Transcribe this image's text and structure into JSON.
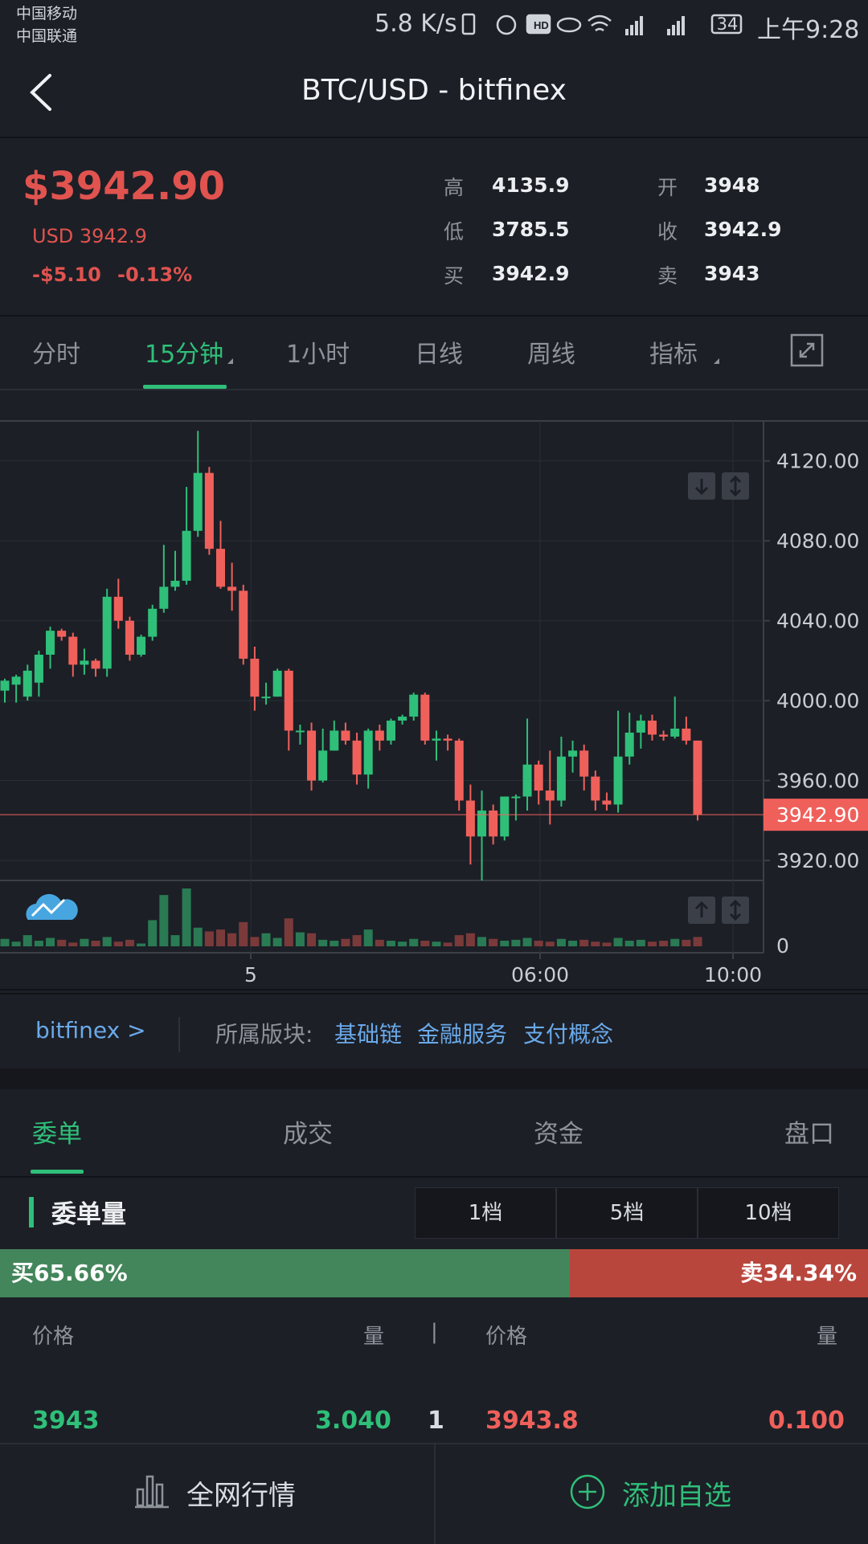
{
  "status_bar": {
    "carrier1": "中国移动",
    "carrier2": "中国联通",
    "speed": "5.8 K/s",
    "battery": "34",
    "time": "上午9:28",
    "icons": [
      "vibrate-icon",
      "alarm-icon",
      "hd-icon",
      "eye-icon",
      "wifi-icon",
      "signal-4g-icon",
      "signal-2g-icon",
      "battery-icon"
    ]
  },
  "header": {
    "title": "BTC/USD - bitfinex",
    "back_icon": "chevron-left-icon"
  },
  "price": {
    "main": "$3942.90",
    "usd": "USD 3942.9",
    "change": "-$5.10",
    "change_pct": "-0.13%",
    "color_down": "#e0534f",
    "quotes": [
      {
        "label": "高",
        "value": "4135.9"
      },
      {
        "label": "开",
        "value": "3948"
      },
      {
        "label": "低",
        "value": "3785.5"
      },
      {
        "label": "收",
        "value": "3942.9"
      },
      {
        "label": "买",
        "value": "3942.9"
      },
      {
        "label": "卖",
        "value": "3943"
      }
    ]
  },
  "tabs": {
    "items": [
      "分时",
      "15分钟",
      "1小时",
      "日线",
      "周线",
      "指标"
    ],
    "active": "15分钟",
    "expand_icon": "fullscreen-icon"
  },
  "chart_data": {
    "type": "candlestick",
    "y_ticks": [
      "4120.00",
      "4080.00",
      "4040.00",
      "4000.00",
      "3960.00",
      "3920.00"
    ],
    "ylim": [
      3910,
      4140
    ],
    "x_ticks": [
      "5",
      "06:00",
      "10:00"
    ],
    "current_price_label": "3942.90",
    "volume_zero_label": "0",
    "up_color": "#2fbf79",
    "down_color": "#f0605b",
    "candles": [
      [
        4005,
        4010,
        3999,
        4011
      ],
      [
        4008,
        4012,
        3999,
        4013
      ],
      [
        4002,
        4015,
        4000,
        4018
      ],
      [
        4009,
        4023,
        4002,
        4025
      ],
      [
        4023,
        4035,
        4016,
        4037
      ],
      [
        4035,
        4032,
        4030,
        4036
      ],
      [
        4032,
        4018,
        4012,
        4034
      ],
      [
        4018,
        4020,
        4013,
        4026
      ],
      [
        4020,
        4016,
        4012,
        4021
      ],
      [
        4016,
        4052,
        4012,
        4056
      ],
      [
        4052,
        4040,
        4036,
        4061
      ],
      [
        4040,
        4023,
        4020,
        4042
      ],
      [
        4023,
        4032,
        4022,
        4033
      ],
      [
        4032,
        4046,
        4030,
        4048
      ],
      [
        4046,
        4057,
        4044,
        4078
      ],
      [
        4057,
        4060,
        4055,
        4075
      ],
      [
        4060,
        4085,
        4058,
        4107
      ],
      [
        4085,
        4114,
        4082,
        4135
      ],
      [
        4114,
        4076,
        4073,
        4117
      ],
      [
        4076,
        4057,
        4056,
        4090
      ],
      [
        4057,
        4055,
        4045,
        4069
      ],
      [
        4055,
        4021,
        4018,
        4058
      ],
      [
        4021,
        4002,
        3995,
        4027
      ],
      [
        4002,
        4002,
        3998,
        4009
      ],
      [
        4002,
        4015,
        4002,
        4016
      ],
      [
        4015,
        3985,
        3975,
        4016
      ],
      [
        3985,
        3985,
        3978,
        3988
      ],
      [
        3985,
        3960,
        3955,
        3989
      ],
      [
        3960,
        3975,
        3959,
        3986
      ],
      [
        3975,
        3985,
        3975,
        3990
      ],
      [
        3985,
        3980,
        3978,
        3989
      ],
      [
        3980,
        3963,
        3958,
        3984
      ],
      [
        3963,
        3985,
        3956,
        3986
      ],
      [
        3985,
        3980,
        3975,
        3988
      ],
      [
        3980,
        3990,
        3978,
        3991
      ],
      [
        3990,
        3992,
        3988,
        3993
      ],
      [
        3992,
        4003,
        3990,
        4004
      ],
      [
        4003,
        3980,
        3978,
        4004
      ],
      [
        3980,
        3981,
        3970,
        3985
      ],
      [
        3981,
        3980,
        3975,
        3983
      ],
      [
        3980,
        3950,
        3945,
        3981
      ],
      [
        3950,
        3932,
        3918,
        3958
      ],
      [
        3932,
        3945,
        3910,
        3955
      ],
      [
        3945,
        3932,
        3928,
        3948
      ],
      [
        3932,
        3952,
        3930,
        3952
      ],
      [
        3952,
        3952,
        3940,
        3953
      ],
      [
        3952,
        3968,
        3945,
        3991
      ],
      [
        3968,
        3955,
        3948,
        3970
      ],
      [
        3955,
        3950,
        3938,
        3975
      ],
      [
        3950,
        3972,
        3947,
        3982
      ],
      [
        3972,
        3975,
        3964,
        3980
      ],
      [
        3975,
        3962,
        3955,
        3978
      ],
      [
        3962,
        3950,
        3945,
        3965
      ],
      [
        3950,
        3948,
        3945,
        3954
      ],
      [
        3948,
        3972,
        3944,
        3995
      ],
      [
        3972,
        3984,
        3968,
        3994
      ],
      [
        3984,
        3990,
        3976,
        3993
      ],
      [
        3990,
        3983,
        3980,
        3993
      ],
      [
        3983,
        3982,
        3980,
        3985
      ],
      [
        3982,
        3986,
        3981,
        4002
      ],
      [
        3986,
        3980,
        3978,
        3992
      ],
      [
        3980,
        3943,
        3940,
        3980
      ]
    ],
    "volumes": [
      8,
      5,
      12,
      6,
      9,
      7,
      4,
      8,
      6,
      10,
      5,
      7,
      3,
      28,
      55,
      12,
      62,
      20,
      16,
      18,
      14,
      26,
      10,
      14,
      9,
      30,
      15,
      14,
      7,
      6,
      8,
      12,
      18,
      7,
      6,
      5,
      8,
      6,
      5,
      4,
      12,
      14,
      10,
      8,
      6,
      7,
      9,
      6,
      5,
      8,
      6,
      7,
      5,
      4,
      9,
      6,
      7,
      5,
      6,
      8,
      7,
      10
    ],
    "drag_icons": [
      "arrow-down-icon",
      "expand-vertical-icon",
      "arrow-up-icon",
      "expand-vertical-icon"
    ],
    "logo_icon": "cloud-logo-icon"
  },
  "info_row": {
    "exchange_link": "bitfinex >",
    "sector_label": "所属版块:",
    "tags": [
      "基础链",
      "金融服务",
      "支付概念"
    ]
  },
  "section_tabs": {
    "items": [
      "委单",
      "成交",
      "资金",
      "盘口"
    ],
    "active": "委单"
  },
  "order_book": {
    "title": "委单量",
    "levels": [
      "1档",
      "5档",
      "10档"
    ],
    "buy_label": "买65.66%",
    "sell_label": "卖34.34%",
    "buy_fraction": 0.6566,
    "buy_color": "#43865b",
    "sell_color": "#b9463d",
    "col_price": "价格",
    "col_qty": "量",
    "col_sep": "|",
    "col_price2": "价格",
    "col_qty2": "量",
    "rows": [
      {
        "bid_price": "3943",
        "bid_qty": "3.040",
        "level": "1",
        "ask_price": "3943.8",
        "ask_qty": "0.100"
      }
    ]
  },
  "bottom_bar": {
    "market": "全网行情",
    "market_icon": "bar-chart-icon",
    "add": "添加自选",
    "add_icon": "plus-circle-icon"
  }
}
